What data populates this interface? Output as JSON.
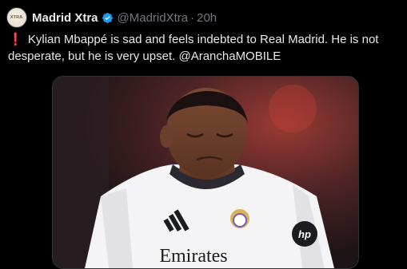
{
  "tweet": {
    "display_name": "Madrid Xtra",
    "handle": "@MadridXtra",
    "separator": "·",
    "time": "20h",
    "avatar_text": "XTRA",
    "exclaim": "❗",
    "text": "Kylian Mbappé is sad and feels indebted to Real Madrid. He is not desperate, but he is very upset. @ArancharMOBILE",
    "mention": "@AranchaMOBILE",
    "body": "Kylian Mbappé is sad and feels indebted to Real Madrid. He is not desperate, but he is very upset.",
    "shirt_text": "Emirates"
  },
  "colors": {
    "background": "#000000",
    "text": "#e7e9ea",
    "muted": "#71767b",
    "verified": "#1d9bf0",
    "exclaim": "#e0245e"
  },
  "icons": {
    "verified": "verified-badge-icon"
  }
}
